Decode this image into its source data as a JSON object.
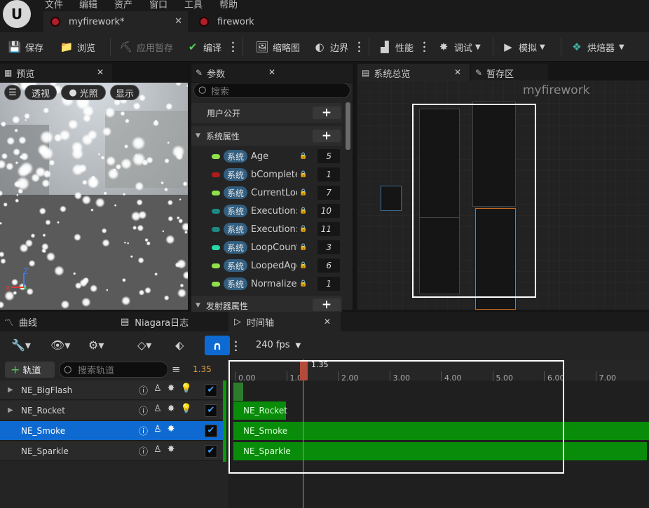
{
  "menu": [
    "文件",
    "编辑",
    "资产",
    "窗口",
    "工具",
    "帮助"
  ],
  "tabs": [
    {
      "label": "myfirework*",
      "active": true
    },
    {
      "label": "firework",
      "active": false
    }
  ],
  "toolbar": {
    "save": "保存",
    "browse": "浏览",
    "apply_pause": "应用暂存",
    "compile": "编译",
    "thumbnail": "缩略图",
    "bounds": "边界",
    "performance": "性能",
    "debug": "调试",
    "simulate": "模拟",
    "baker": "烘焙器"
  },
  "preview": {
    "title": "预览",
    "perspective": "透视",
    "lit": "光照",
    "show": "显示",
    "axis_x": "x",
    "axis_z": "Z"
  },
  "params": {
    "title": "参数",
    "search_placeholder": "搜索",
    "user_exposed": "用户公开",
    "system_props": "系统属性",
    "emitter_props": "发射器属性",
    "rows": [
      {
        "badge": "系统",
        "name": "Age",
        "value": "5",
        "color": "#8fe04a"
      },
      {
        "badge": "系统",
        "name": "bComplete(",
        "value": "1",
        "color": "#b01c1c"
      },
      {
        "badge": "系统",
        "name": "CurrentLoo",
        "value": "7",
        "color": "#8fe04a"
      },
      {
        "badge": "系统",
        "name": "Execution:",
        "value": "10",
        "color": "#1d8a82"
      },
      {
        "badge": "系统",
        "name": "Execution:",
        "value": "11",
        "color": "#1d8a82"
      },
      {
        "badge": "系统",
        "name": "LoopCount",
        "value": "3",
        "color": "#27d9a8"
      },
      {
        "badge": "系统",
        "name": "LoopedAge",
        "value": "6",
        "color": "#8fe04a"
      },
      {
        "badge": "系统",
        "name": "Normalized",
        "value": "1",
        "color": "#8fe04a"
      }
    ]
  },
  "overview": {
    "title": "系统总览",
    "staging": "暂存区",
    "graph_title": "myfirework"
  },
  "bottom": {
    "curves": "曲线",
    "niagara_log": "Niagara日志",
    "timeline": "时间轴"
  },
  "sequencer": {
    "fps": "240 fps",
    "add_track": "轨道",
    "search_placeholder": "搜索轨道",
    "time_value": "1.35",
    "playhead_label": "1.35",
    "ticks": [
      "0.00",
      "1.00",
      "2.00",
      "3.00",
      "4.00",
      "5.00",
      "6.00",
      "7.00"
    ],
    "tracks": [
      {
        "name": "NE_BigFlash",
        "expandable": true,
        "selected": false
      },
      {
        "name": "NE_Rocket",
        "expandable": true,
        "selected": false
      },
      {
        "name": "NE_Smoke",
        "expandable": false,
        "selected": true
      },
      {
        "name": "NE_Sparkle",
        "expandable": false,
        "selected": false
      }
    ],
    "bars": [
      "NE_Rocket",
      "NE_Smoke",
      "NE_Sparkle"
    ]
  },
  "colors": {
    "accent": "#0e6ad0",
    "bar_green": "#098c09",
    "badge_blue": "#325e80"
  }
}
